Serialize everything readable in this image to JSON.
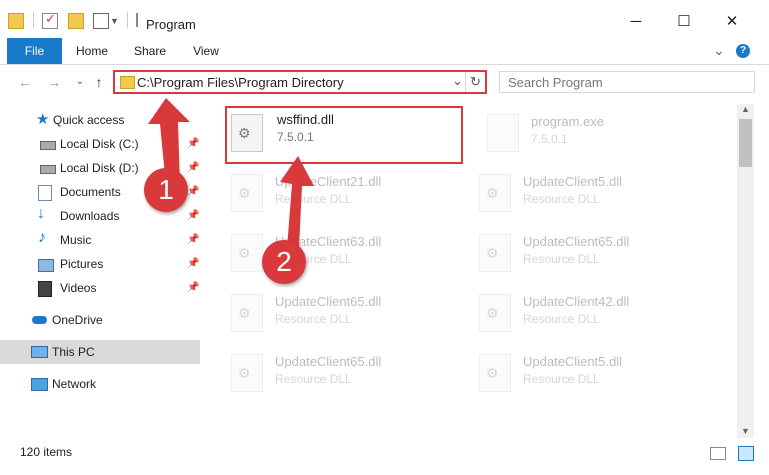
{
  "window": {
    "title": "Program",
    "minimize": "─",
    "maximize": "☐",
    "close": "✕"
  },
  "ribbon": {
    "tabs": [
      "File",
      "Home",
      "Share",
      "View"
    ],
    "help": "?",
    "expand": "⌄"
  },
  "address": {
    "path": "C:\\Program Files\\Program Directory",
    "dropdown": "⌄",
    "refresh": "↻",
    "search_placeholder": "Search Program"
  },
  "nav": {
    "back": "←",
    "forward": "→",
    "recent": "⌄",
    "up": "↑"
  },
  "sidebar": {
    "items": [
      {
        "label": "Quick access",
        "icon": "star-icon",
        "pinned": false
      },
      {
        "label": "Local Disk (C:)",
        "icon": "drive-icon",
        "pinned": true
      },
      {
        "label": "Local Disk (D:)",
        "icon": "drive-icon",
        "pinned": true
      },
      {
        "label": "Documents",
        "icon": "documents-icon",
        "pinned": true
      },
      {
        "label": "Downloads",
        "icon": "downloads-icon",
        "pinned": true
      },
      {
        "label": "Music",
        "icon": "music-icon",
        "pinned": true
      },
      {
        "label": "Pictures",
        "icon": "pictures-icon",
        "pinned": true
      },
      {
        "label": "Videos",
        "icon": "videos-icon",
        "pinned": true
      },
      {
        "label": "OneDrive",
        "icon": "onedrive-icon",
        "pinned": false
      },
      {
        "label": "This PC",
        "icon": "pc-icon",
        "pinned": false
      },
      {
        "label": "Network",
        "icon": "network-icon",
        "pinned": false
      }
    ]
  },
  "files": [
    {
      "name": "wsffind.dll",
      "sub": "7.5.0.1"
    },
    {
      "name": "program.exe",
      "sub": "7.5.0.1"
    },
    {
      "name": "UpdateClient21.dll",
      "sub": "Resource DLL"
    },
    {
      "name": "UpdateClient5.dll",
      "sub": "Resource DLL"
    },
    {
      "name": "UpdateClient63.dll",
      "sub": "Resource DLL"
    },
    {
      "name": "UpdateClient65.dll",
      "sub": "Resource DLL"
    },
    {
      "name": "UpdateClient65.dll",
      "sub": "Resource DLL"
    },
    {
      "name": "UpdateClient42.dll",
      "sub": "Resource DLL"
    },
    {
      "name": "UpdateClient65.dll",
      "sub": "Resource DLL"
    },
    {
      "name": "UpdateClient5.dll",
      "sub": "Resource DLL"
    }
  ],
  "status": {
    "count": "120 items"
  },
  "annotations": {
    "step1": "1",
    "step2": "2"
  },
  "colors": {
    "accent": "#1979ca",
    "highlight": "#d9393a",
    "selected": "#cce8ff"
  }
}
